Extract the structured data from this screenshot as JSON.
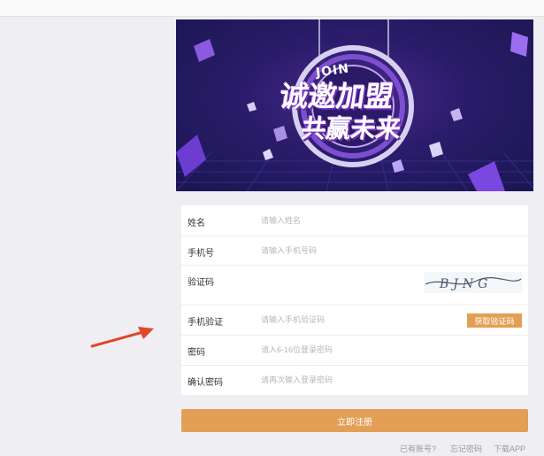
{
  "banner": {
    "join_text": "JOIN",
    "line1": "诚邀加盟",
    "line2": "共赢未来"
  },
  "form": {
    "rows": [
      {
        "label": "姓名",
        "placeholder": "请输入姓名"
      },
      {
        "label": "手机号",
        "placeholder": "请输入手机号码"
      },
      {
        "label": "验证码",
        "placeholder": "",
        "captcha_text": "BJNG"
      },
      {
        "label": "手机验证",
        "placeholder": "请输入手机验证码",
        "button": "获取验证码"
      },
      {
        "label": "密码",
        "placeholder": "请入6-16位登录密码"
      },
      {
        "label": "确认密码",
        "placeholder": "请再次输入登录密码"
      }
    ]
  },
  "submit_label": "立即注册",
  "footer_links": {
    "have_account": "已有账号?",
    "forgot_password": "忘记密码",
    "download_app": "下载APP"
  },
  "colors": {
    "accent": "#e39f55",
    "page_bg": "#efeff3",
    "arrow": "#e2452b"
  }
}
